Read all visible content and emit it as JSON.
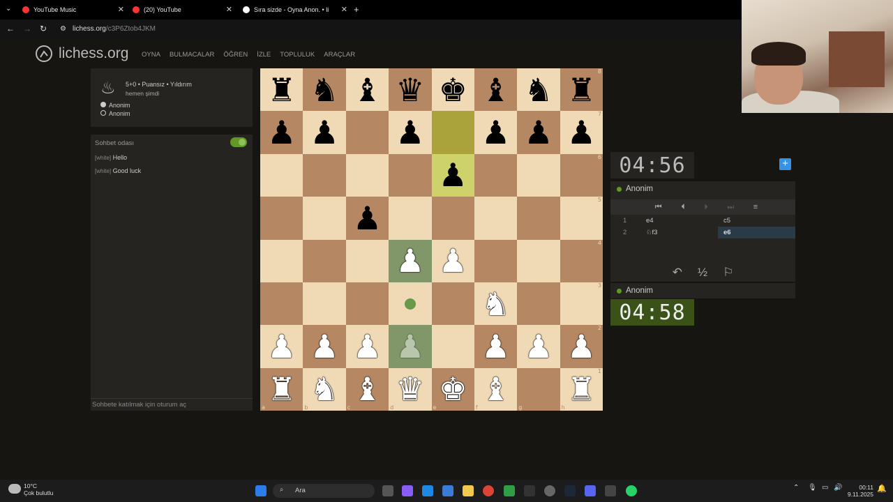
{
  "browser": {
    "tabs": [
      {
        "title": "YouTube Music"
      },
      {
        "title": "(20) YouTube"
      },
      {
        "title": "Sıra sizde - Oyna Anon. • li"
      }
    ],
    "url_host": "lichess.org",
    "url_path": "/c3P6Ztob4JKM"
  },
  "site": {
    "logo": "lichess.org",
    "menu": [
      "OYNA",
      "BULMACALAR",
      "ÖĞREN",
      "İZLE",
      "TOPLULUK",
      "ARAÇLAR"
    ]
  },
  "game_info": {
    "mode": "5+0 • Puansız • Yıldırım",
    "time": "hemen şimdi",
    "players": [
      "Anonim",
      "Anonim"
    ]
  },
  "chat": {
    "title": "Sohbet odası",
    "lines": [
      {
        "who": "[white]",
        "text": "Hello"
      },
      {
        "who": "[white]",
        "text": "Good luck"
      }
    ],
    "input_placeholder": "Sohbete katılmak için oturum aç"
  },
  "board": {
    "ranks": [
      "8",
      "7",
      "6",
      "5",
      "4",
      "3",
      "2",
      "1"
    ],
    "files": [
      "a",
      "b",
      "c",
      "d",
      "e",
      "f",
      "g",
      "h"
    ],
    "position": [
      [
        "bR",
        "bN",
        "bB",
        "bQ",
        "bK",
        "bB",
        "bN",
        "bR"
      ],
      [
        "bP",
        "bP",
        "",
        "bP",
        "",
        "bP",
        "bP",
        "bP"
      ],
      [
        "",
        "",
        "",
        "",
        "bP",
        "",
        "",
        ""
      ],
      [
        "",
        "",
        "bP",
        "",
        "",
        "",
        "",
        ""
      ],
      [
        "",
        "",
        "",
        "wP",
        "wP",
        "",
        "",
        ""
      ],
      [
        "",
        "",
        "",
        "",
        "",
        "wN",
        "",
        ""
      ],
      [
        "wP",
        "wP",
        "wP",
        "wP",
        "",
        "wP",
        "wP",
        "wP"
      ],
      [
        "wR",
        "wN",
        "wB",
        "wQ",
        "wK",
        "wB",
        "",
        "wR"
      ]
    ]
  },
  "clocks": {
    "opponent": "04:56",
    "self": "04:58"
  },
  "players": {
    "top": "Anonim",
    "bottom": "Anonim"
  },
  "moves": [
    {
      "n": "1",
      "w": "e4",
      "b": "c5"
    },
    {
      "n": "2",
      "w": "♘f3",
      "b": "e6"
    }
  ],
  "taskbar": {
    "temp": "10°C",
    "weather": "Çok bulutlu",
    "search": "Ara",
    "time": "00:11",
    "date": "9.11.2025"
  }
}
